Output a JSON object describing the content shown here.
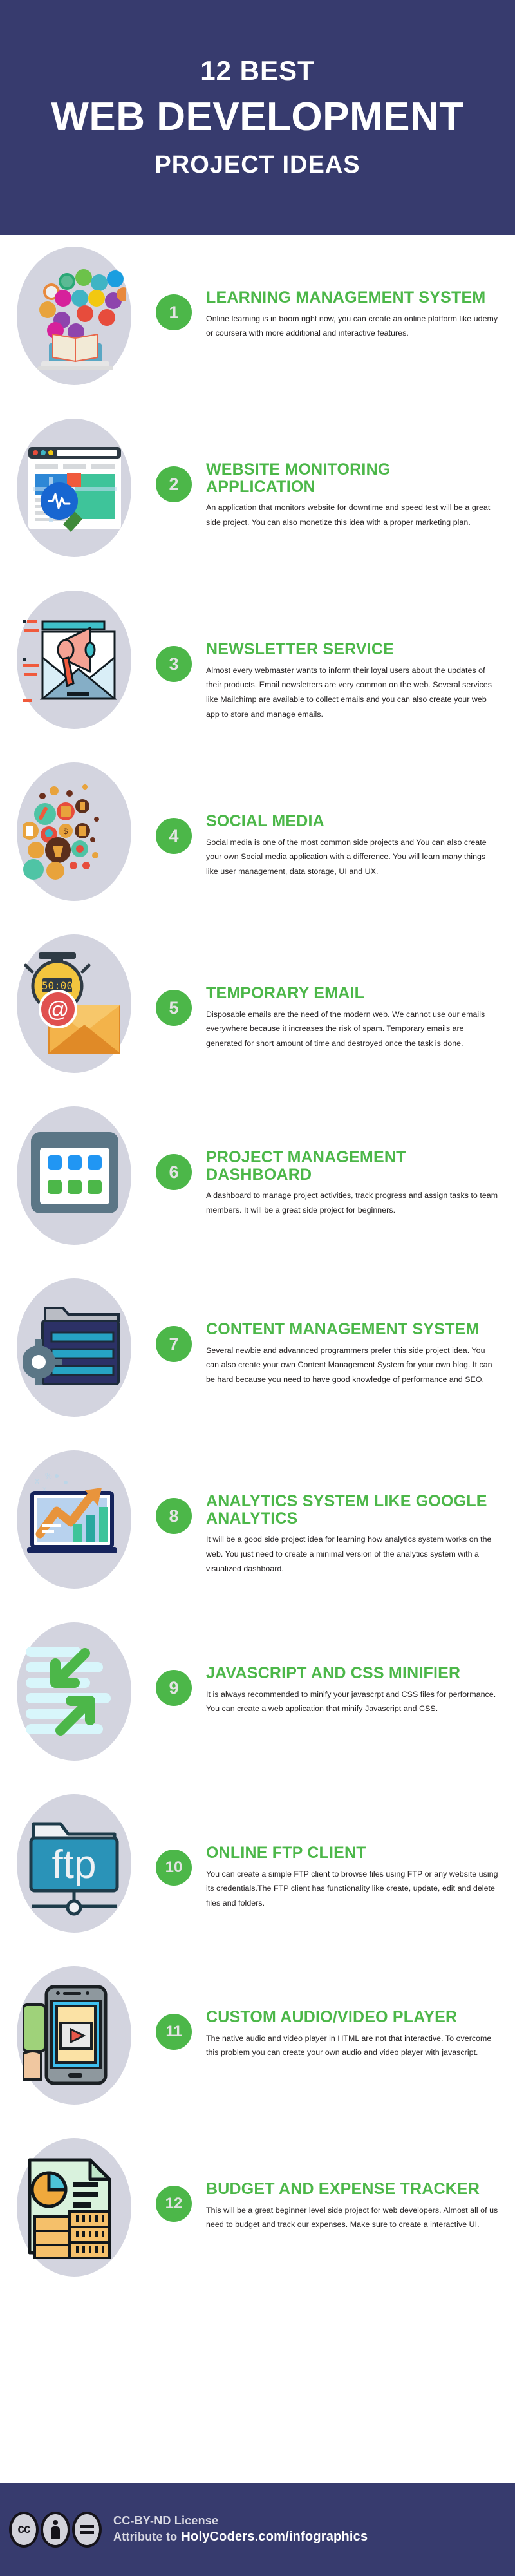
{
  "header": {
    "line1": "12 BEST",
    "line2": "WEB DEVELOPMENT",
    "line3": "PROJECT IDEAS",
    "bg_color": "#373b6e",
    "text_color": "#ffffff"
  },
  "theme": {
    "accent_green": "#4cb749",
    "badge_number_color": "#e3e3e3",
    "illustration_circle": "#d3d4df",
    "body_text_color": "#231f20"
  },
  "items": [
    {
      "number": "1",
      "title": "LEARNING MANAGEMENT SYSTEM",
      "description": "Online learning is in boom right now, you can create an online platform like udemy or coursera with more additional and interactive features.",
      "icon": "laptop-with-open-book-and-subject-bubbles-icon"
    },
    {
      "number": "2",
      "title": "WEBSITE MONITORING APPLICATION",
      "description": "An application that monitors website for downtime and speed test will be a great side project. You can also monetize this idea with a proper marketing plan.",
      "icon": "browser-window-with-magnifier-pulse-icon"
    },
    {
      "number": "3",
      "title": "NEWSLETTER SERVICE",
      "description": "Almost every webmaster wants to inform their loyal users about the updates of their products. Email newsletters are very common on the web. Several services like Mailchimp are available to collect emails and you can also create your web app to store and manage emails.",
      "icon": "envelope-with-megaphone-icon"
    },
    {
      "number": "4",
      "title": "SOCIAL MEDIA",
      "description": "Social media is one of the most common side projects and You can also create your own Social media application with a difference. You will learn many things like user management, data storage, UI and UX.",
      "icon": "megaphone-with-app-bubbles-icon"
    },
    {
      "number": "5",
      "title": "TEMPORARY EMAIL",
      "description": "Disposable emails are the need of the modern web. We cannot use our emails everywhere because it increases the risk of spam. Temporary emails are generated for short amount of time and destroyed once the task is done.",
      "icon": "stopwatch-with-at-sign-envelope-icon"
    },
    {
      "number": "6",
      "title": "PROJECT MANAGEMENT DASHBOARD",
      "description": "A dashboard to manage project activities, track progress and assign tasks to team members. It will be a great side project for beginners.",
      "icon": "dashboard-tiles-window-icon"
    },
    {
      "number": "7",
      "title": "CONTENT MANAGEMENT SYSTEM",
      "description": "Several newbie and advannced programmers prefer this side project idea. You can also create your own Content Management System for your own blog. It can be hard because you need to have good knowledge of performance and SEO.",
      "icon": "document-with-gear-icon"
    },
    {
      "number": "8",
      "title": "ANALYTICS SYSTEM LIKE GOOGLE ANALYTICS",
      "description": "It will be a good side project idea for learning how analytics system works on the web. You just need to create a minimal version of the analytics system with a visualized dashboard.",
      "icon": "laptop-with-growth-chart-icon"
    },
    {
      "number": "9",
      "title": "JAVASCRIPT AND CSS MINIFIER",
      "description": "It is always recommended to minify your javascrpt and CSS files for performance. You can create a web application that minify Javascript and CSS.",
      "icon": "compress-arrows-icon"
    },
    {
      "number": "10",
      "title": "ONLINE FTP CLIENT",
      "description": "You can create a simple FTP client to browse files using FTP or any website using its credentials.The FTP client has functionality like create, update, edit and delete files and folders.",
      "icon": "ftp-folder-icon"
    },
    {
      "number": "11",
      "title": "CUSTOM AUDIO/VIDEO PLAYER",
      "description": "The native audio and video player in HTML are not that interactive. To overcome this problem you can create your own audio and video player with javascript.",
      "icon": "smartphone-video-player-with-hand-icon"
    },
    {
      "number": "12",
      "title": "BUDGET AND EXPENSE TRACKER",
      "description": "This will be a great beginner level side project for web developers. Almost all of us need to budget and track our expenses. Make sure to create a interactive UI.",
      "icon": "pie-chart-report-with-money-stacks-icon"
    }
  ],
  "footer": {
    "cc_icon_label": "cc",
    "by_icon_label": "by-person-icon",
    "nd_icon_label": "no-derivatives-equals-icon",
    "license_line": "CC-BY-ND License",
    "attribute_prefix": "Attribute to",
    "attribute_site": "HolyCoders.com/infographics",
    "bg_color": "#373b6e"
  }
}
